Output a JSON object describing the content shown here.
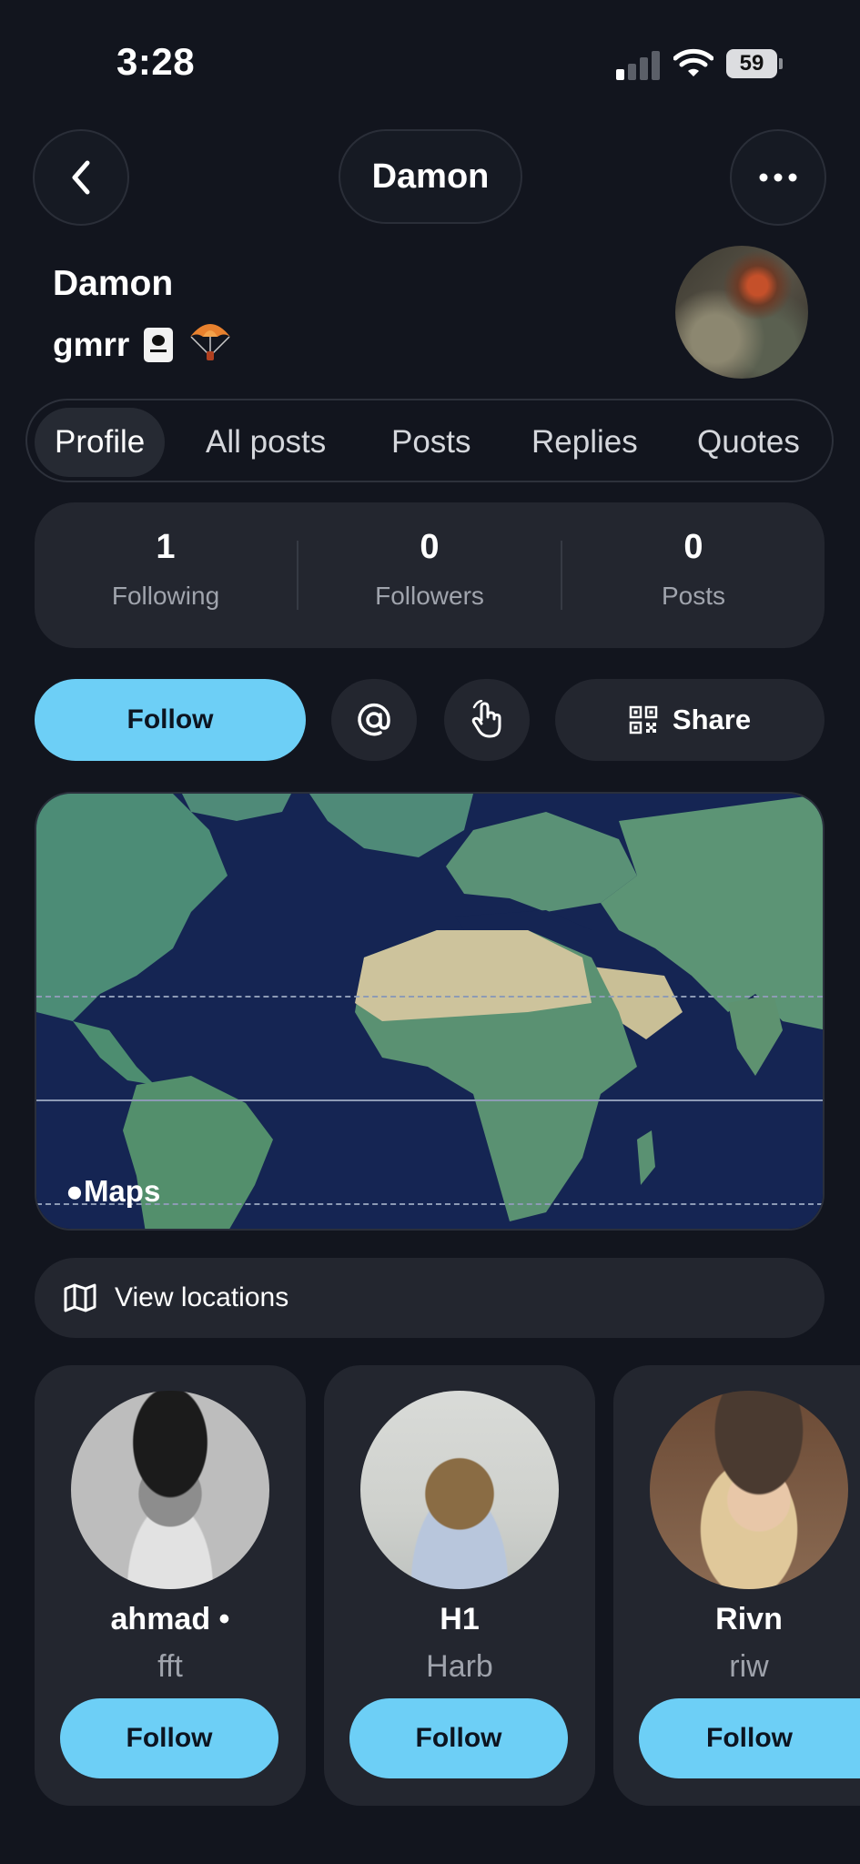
{
  "status_bar": {
    "time": "3:28",
    "battery": "59"
  },
  "nav": {
    "title": "Damon"
  },
  "profile": {
    "name": "Damon",
    "handle": "gmrr"
  },
  "tabs": [
    {
      "label": "Profile"
    },
    {
      "label": "All posts"
    },
    {
      "label": "Posts"
    },
    {
      "label": "Replies"
    },
    {
      "label": "Quotes"
    }
  ],
  "stats": [
    {
      "value": "1",
      "label": "Following"
    },
    {
      "value": "0",
      "label": "Followers"
    },
    {
      "value": "0",
      "label": "Posts"
    }
  ],
  "actions": {
    "follow": "Follow",
    "share": "Share"
  },
  "map": {
    "label": "Maps"
  },
  "view_locations": "View locations",
  "suggestions": [
    {
      "name": "ahmad",
      "sub": "fft",
      "follow": "Follow"
    },
    {
      "name": "H1",
      "sub": "Harb",
      "follow": "Follow"
    },
    {
      "name": "Rivn",
      "sub": "riw",
      "follow": "Follow"
    }
  ],
  "colors": {
    "background": "#12151e",
    "card": "#23262f",
    "accent": "#6dcff6"
  }
}
